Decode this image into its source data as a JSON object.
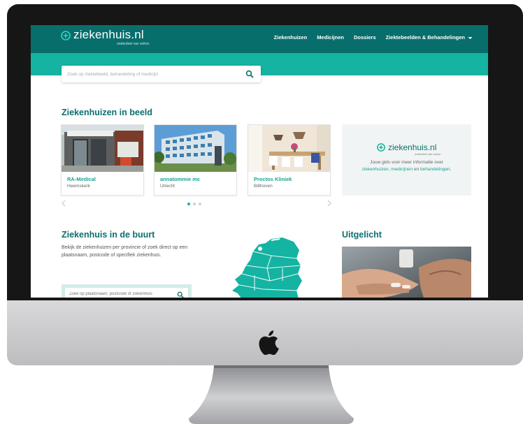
{
  "header": {
    "logo_text": "ziekenhuis.nl",
    "logo_sub": "onderdeel van sohvo",
    "nav": [
      "Ziekenhuizen",
      "Medicijnen",
      "Dossiers",
      "Ziektebeelden & Behandelingen"
    ]
  },
  "search": {
    "placeholder": "Zoek op ziektebeeld, behandeling of medicijn"
  },
  "hospitals": {
    "title": "Ziekenhuizen in beeld",
    "cards": [
      {
        "name": "RA-Medical",
        "city": "Heemskerk"
      },
      {
        "name": "annatommie mc",
        "city": "Utrecht"
      },
      {
        "name": "Proctos Kliniek",
        "city": "Bilthoven"
      }
    ]
  },
  "promo": {
    "logo_text": "ziekenhuis.nl",
    "logo_sub": "onderdeel van sohvo",
    "line1": "Jouw gids voor meer informatie over",
    "link1": "ziekenhuizen",
    "sep1": ", ",
    "link2": "medicijnen",
    "sep2": " en ",
    "link3": "behandelingen",
    "end": "."
  },
  "nearby": {
    "title": "Ziekenhuis in de buurt",
    "description": "Bekijk de ziekenhuizen per provincie of zoek direct op een plaatsnaam, postcode of specifiek ziekenhuis.",
    "placeholder": "Zoek op plaatsnaam, postcode of ziekenhuis"
  },
  "featured": {
    "title": "Uitgelicht"
  },
  "colors": {
    "nav": "#086e6c",
    "accent": "#14b3a2",
    "heading": "#0c6f6e"
  }
}
